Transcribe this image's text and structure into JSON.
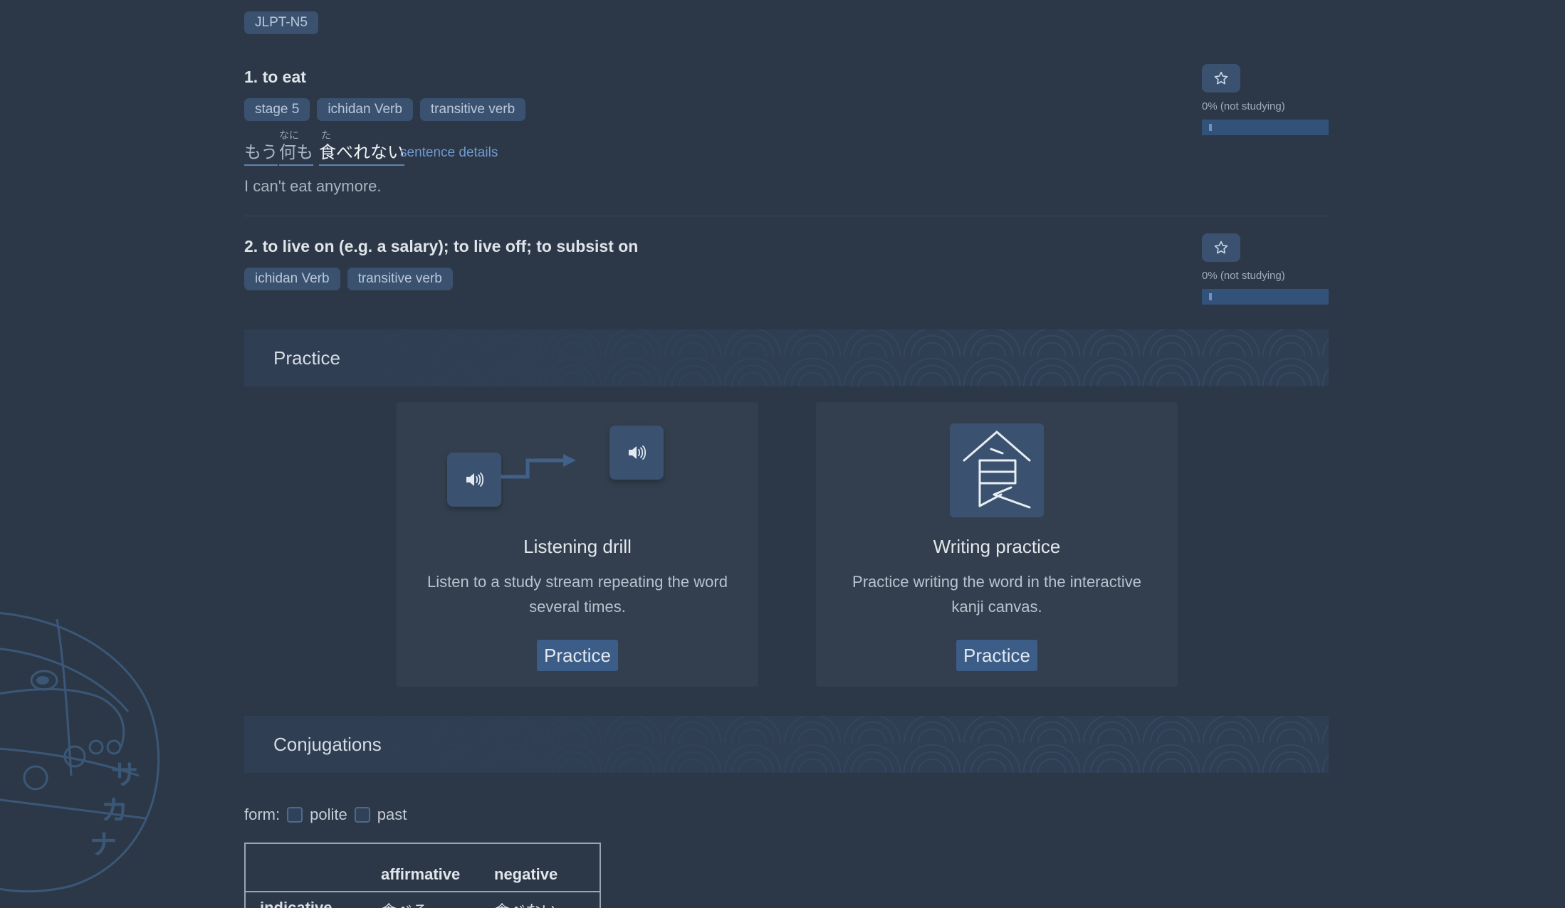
{
  "jlpt_tag": "JLPT-N5",
  "senses": [
    {
      "title": "1. to eat",
      "tags": [
        "stage 5",
        "ichidan Verb",
        "transitive verb"
      ],
      "sentence": {
        "words": [
          {
            "text": "もう",
            "furigana": ""
          },
          {
            "text": "何も",
            "furigana": "なに"
          },
          {
            "text": "食べれない",
            "furigana": "た"
          }
        ],
        "details_link": "sentence details"
      },
      "translation": "I can't eat anymore.",
      "status": "0% (not studying)",
      "progress": 0.0
    },
    {
      "title": "2. to live on (e.g. a salary); to live off; to subsist on",
      "tags": [
        "ichidan Verb",
        "transitive verb"
      ],
      "status": "0% (not studying)",
      "progress": 0.0
    }
  ],
  "practice": {
    "title": "Practice",
    "cards": [
      {
        "title": "Listening drill",
        "description": "Listen to a study stream repeating the word several times.",
        "button": "Practice",
        "icon": "speaker-icon"
      },
      {
        "title": "Writing practice",
        "description": "Practice writing the word in the interactive kanji canvas.",
        "button": "Practice",
        "kanji": "食"
      }
    ]
  },
  "conjugations": {
    "title": "Conjugations",
    "form_label": "form:",
    "options": [
      "polite",
      "past"
    ],
    "columns": [
      "affirmative",
      "negative"
    ],
    "rows": [
      {
        "label": "indicative",
        "affirmative": "食べる",
        "negative": "食べない"
      }
    ]
  },
  "mascot_text": "サカナ",
  "colors": {
    "background": "#2c3847",
    "tag_bg": "#3a5270",
    "accent_link": "#6f9ad0",
    "button_bg": "#3b5d88"
  }
}
